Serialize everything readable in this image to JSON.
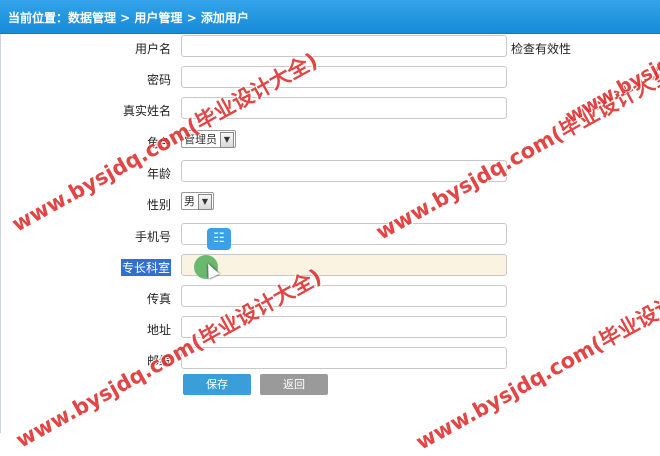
{
  "header": {
    "breadcrumb": "当前位置：数据管理 > 用户管理 > 添加用户"
  },
  "form": {
    "username_label": "用户名",
    "username_value": "",
    "username_hint": "检查有效性",
    "password_label": "密码",
    "password_value": "",
    "realname_label": "真实姓名",
    "realname_value": "",
    "role_label": "角色",
    "role_value": "管理员",
    "age_label": "年龄",
    "age_value": "",
    "gender_label": "性别",
    "gender_value": "男",
    "phone_label": "手机号",
    "phone_value": "",
    "department_label": "专长科室",
    "department_value": "",
    "fax_label": "传真",
    "fax_value": "",
    "address_label": "地址",
    "address_value": "",
    "zipcode_label": "邮编",
    "zipcode_value": ""
  },
  "buttons": {
    "save_label": "保存",
    "back_label": "返回"
  },
  "overlay": {
    "floating_icon": "clipboard-icon"
  },
  "watermarks": {
    "w1": "www.bysjdq.com(毕业设计大全)",
    "w2": "www.bysjdq.com(毕业设计大全)",
    "w3": "www.bysjdq.com(毕业设计大全)",
    "w4": "www.bysjdq.com(毕业设计大全)",
    "w5": "www.bysjdq.com(毕业设计大全)"
  },
  "colors": {
    "header": "#168bd8",
    "save_button": "#3a9fd8",
    "back_button": "#9a9a9a",
    "watermark": "#e03030"
  }
}
